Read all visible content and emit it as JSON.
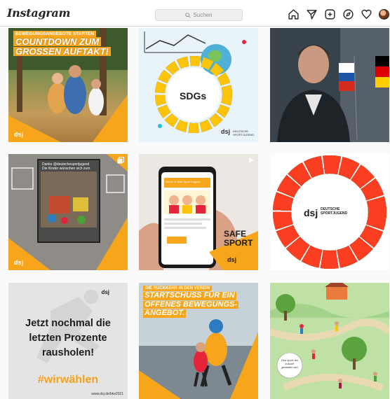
{
  "app": {
    "logo": "Instagram"
  },
  "search": {
    "placeholder": "Suchen"
  },
  "nav": {
    "icons": [
      "home-icon",
      "direct-icon",
      "new-post-icon",
      "explore-icon",
      "activity-icon",
      "profile-avatar"
    ]
  },
  "colors": {
    "accent": "#f7a51b",
    "border": "#dbdbdb",
    "text": "#262626"
  },
  "posts": [
    {
      "kicker": "BEWEGUNGSANGEBOTE STARTEN",
      "headline_1": "COUNTDOWN ZUM",
      "headline_2": "GROSSEN AUFTAKT!",
      "brand": "dsj"
    },
    {
      "label": "SDGs",
      "brand": "dsj",
      "brand_sub": "DEUTSCHE SPORTJUGEND"
    },
    {},
    {
      "card_text": "Danke @deutschesportjugend Die Kinder wünschen sich zum",
      "brand": "dsj"
    },
    {
      "phone_title": "Sicher & Safe Sport Legend",
      "label_1": "SAFE",
      "label_2": "SPORT",
      "brand": "dsj"
    },
    {
      "brand": "dsj",
      "brand_sub": "DEUTSCHE SPORTJUGEND"
    },
    {
      "line_1": "Jetzt nochmal die",
      "line_2": "letzten Prozente",
      "line_3": "rausholen!",
      "hashtag": "#wirwählen",
      "url": "www.dsj.de/btw2021",
      "brand": "dsj"
    },
    {
      "kicker": "DIE RÜCKKEHR IN DEN VEREIN",
      "headline_1": "STARTSCHUSS FÜR EIN",
      "headline_2": "OFFENES BEWEGUNGS-",
      "headline_3": "ANGEBOT."
    },
    {
      "bubble_text": "Den sport der zukunft gestalten wir!"
    }
  ]
}
